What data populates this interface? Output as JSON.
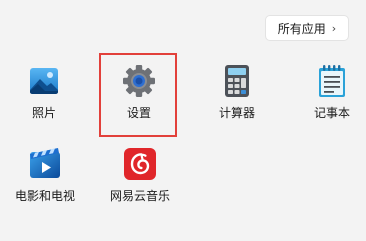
{
  "header": {
    "all_apps_label": "所有应用",
    "all_apps_chevron": "›"
  },
  "apps": [
    {
      "label": "照片",
      "icon": "photos-icon"
    },
    {
      "label": "设置",
      "icon": "gear-icon",
      "highlighted": true
    },
    {
      "label": "计算器",
      "icon": "calculator-icon"
    },
    {
      "label": "记事本",
      "icon": "notepad-icon"
    },
    {
      "label": "电影和电视",
      "icon": "movies-tv-icon"
    },
    {
      "label": "网易云音乐",
      "icon": "netease-music-icon"
    }
  ],
  "colors": {
    "highlight": "#e2403a",
    "background": "#f3f3f3"
  }
}
